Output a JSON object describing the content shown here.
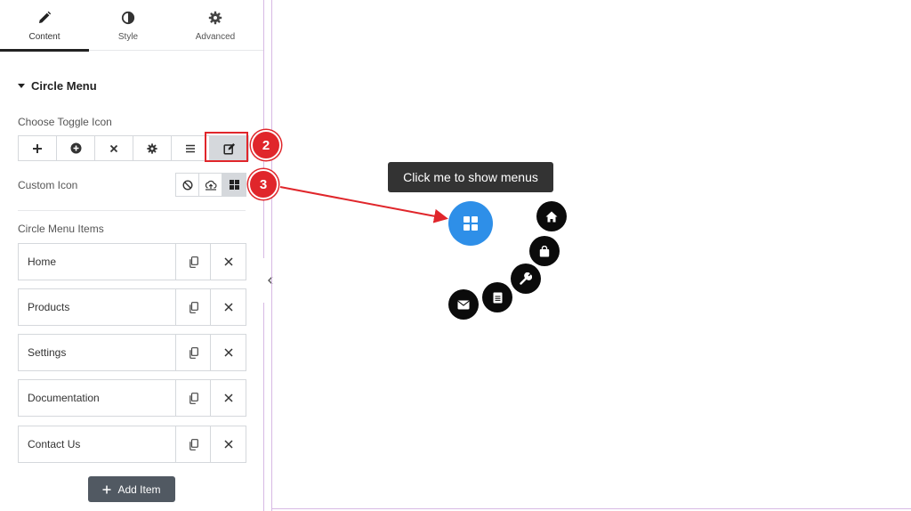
{
  "tabs": [
    {
      "label": "Content",
      "icon": "pencil-icon"
    },
    {
      "label": "Style",
      "icon": "contrast-icon"
    },
    {
      "label": "Advanced",
      "icon": "gear-icon"
    }
  ],
  "section": {
    "title": "Circle Menu"
  },
  "toggle_icon": {
    "label": "Choose Toggle Icon",
    "options": [
      "plus-icon",
      "plus-circle-icon",
      "close-icon",
      "gear-icon",
      "bars-icon",
      "edit-icon"
    ],
    "selected": "edit-icon"
  },
  "custom_icon": {
    "label": "Custom Icon",
    "options": [
      "none-icon",
      "upload-icon",
      "grid-icon"
    ],
    "selected": "grid-icon"
  },
  "items_section": {
    "label": "Circle Menu Items",
    "items": [
      {
        "title": "Home"
      },
      {
        "title": "Products"
      },
      {
        "title": "Settings"
      },
      {
        "title": "Documentation"
      },
      {
        "title": "Contact Us"
      }
    ],
    "add_label": "Add Item"
  },
  "preview": {
    "tooltip": "Click me to show menus",
    "toggle_color": "#2e8fe8",
    "menu_icons": [
      "home-icon",
      "bag-icon",
      "wrench-icon",
      "document-icon",
      "envelope-icon"
    ]
  },
  "annotations": {
    "step_2": "2",
    "step_3": "3",
    "color": "#e0262b"
  }
}
